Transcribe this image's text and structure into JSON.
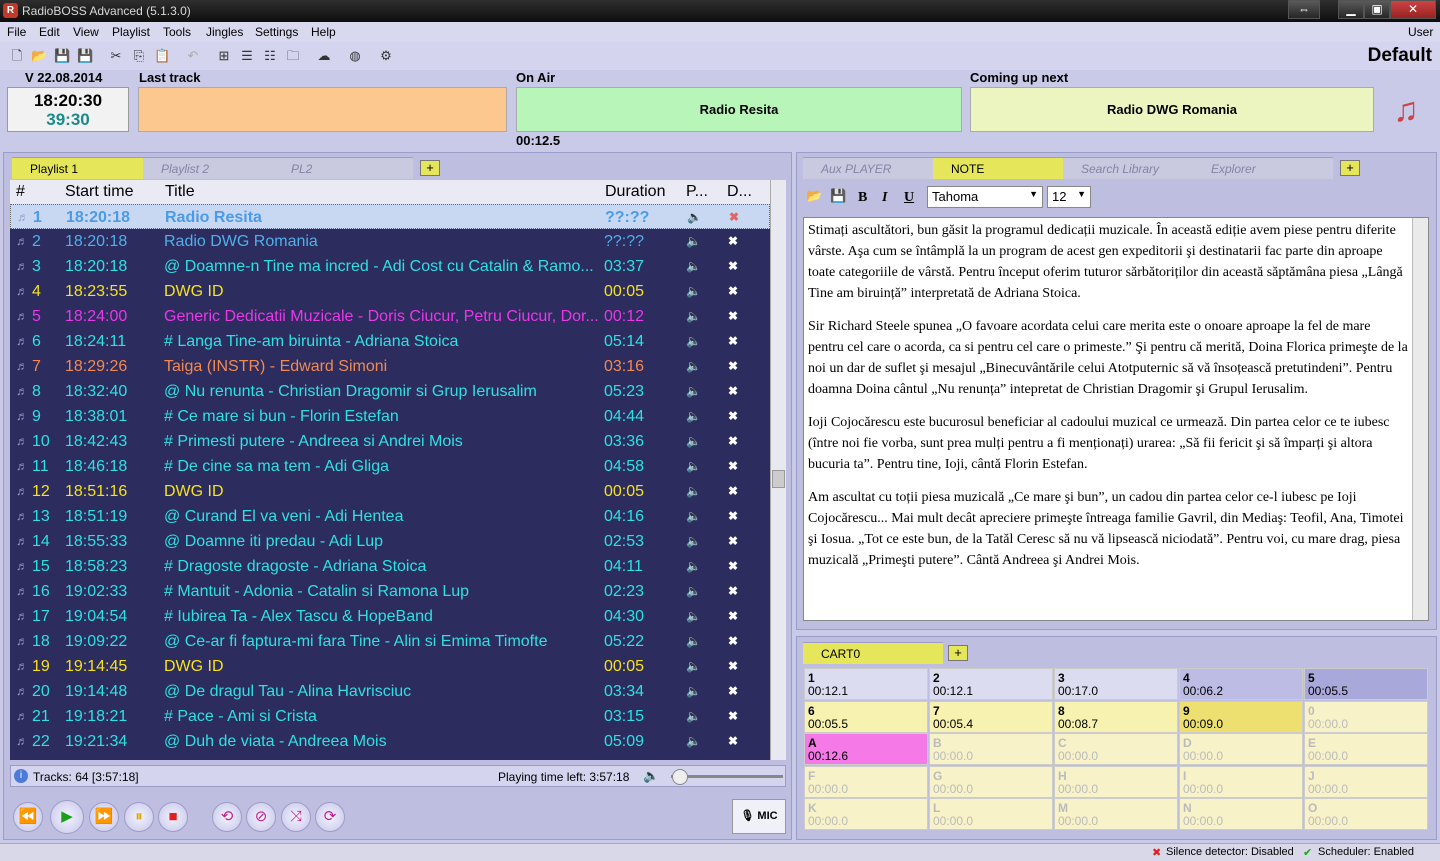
{
  "app": {
    "title": "RadioBOSS Advanced (5.1.3.0)",
    "profile": "Default",
    "user_label": "User"
  },
  "menu": [
    "File",
    "Edit",
    "View",
    "Playlist",
    "Tools",
    "Jingles",
    "Settings",
    "Help"
  ],
  "status": {
    "date": "V 22.08.2014",
    "clock": "18:20:30",
    "remaining": "39:30",
    "last_track_label": "Last track",
    "last_track": "",
    "on_air_label": "On Air",
    "on_air": "Radio Resita",
    "on_air_elapsed": "00:12.5",
    "next_label": "Coming up next",
    "next": "Radio DWG Romania",
    "colors": {
      "last": "#fcc890",
      "on_air": "#b8f5b8",
      "next": "#ecf5c0"
    }
  },
  "playlist": {
    "tabs": [
      "Playlist 1",
      "Playlist 2",
      "PL2"
    ],
    "headers": {
      "num": "#",
      "start": "Start time",
      "title": "Title",
      "duration": "Duration",
      "p": "P...",
      "d": "D..."
    },
    "rows": [
      {
        "n": "1",
        "start": "18:20:18",
        "title": "Radio Resita",
        "dur": "??:??",
        "color": "#4b9be8"
      },
      {
        "n": "2",
        "start": "18:20:18",
        "title": "Radio DWG Romania",
        "dur": "??:??",
        "color": "#4fb0ea"
      },
      {
        "n": "3",
        "start": "18:20:18",
        "title": "@ Doamne-n Tine ma incred - Adi Cost cu Catalin & Ramo...",
        "dur": "03:37",
        "color": "#2fe0e0"
      },
      {
        "n": "4",
        "start": "18:23:55",
        "title": "DWG ID",
        "dur": "00:05",
        "color": "#f5e21e"
      },
      {
        "n": "5",
        "start": "18:24:00",
        "title": "Generic Dedicatii Muzicale - Doris Ciucur, Petru Ciucur, Dor...",
        "dur": "00:12",
        "color": "#e838e8"
      },
      {
        "n": "6",
        "start": "18:24:11",
        "title": "# Langa Tine-am biruinta - Adriana Stoica",
        "dur": "05:14",
        "color": "#2fe0e0"
      },
      {
        "n": "7",
        "start": "18:29:26",
        "title": "Taiga (INSTR) - Edward Simoni",
        "dur": "03:16",
        "color": "#f08a52"
      },
      {
        "n": "8",
        "start": "18:32:40",
        "title": "@ Nu renunta - Christian Dragomir si Grup Ierusalim",
        "dur": "05:23",
        "color": "#2fe0e0"
      },
      {
        "n": "9",
        "start": "18:38:01",
        "title": "# Ce mare si bun - Florin Estefan",
        "dur": "04:44",
        "color": "#2fe0e0"
      },
      {
        "n": "10",
        "start": "18:42:43",
        "title": "# Primesti putere - Andreea si Andrei Mois",
        "dur": "03:36",
        "color": "#2fe0e0"
      },
      {
        "n": "11",
        "start": "18:46:18",
        "title": "# De cine sa ma tem - Adi Gliga",
        "dur": "04:58",
        "color": "#2fe0e0"
      },
      {
        "n": "12",
        "start": "18:51:16",
        "title": "DWG ID",
        "dur": "00:05",
        "color": "#f5e21e"
      },
      {
        "n": "13",
        "start": "18:51:19",
        "title": "@ Curand El va veni - Adi Hentea",
        "dur": "04:16",
        "color": "#2fe0e0"
      },
      {
        "n": "14",
        "start": "18:55:33",
        "title": "@ Doamne iti predau - Adi Lup",
        "dur": "02:53",
        "color": "#2fe0e0"
      },
      {
        "n": "15",
        "start": "18:58:23",
        "title": "# Dragoste dragoste - Adriana Stoica",
        "dur": "04:11",
        "color": "#2fe0e0"
      },
      {
        "n": "16",
        "start": "19:02:33",
        "title": "# Mantuit - Adonia - Catalin si Ramona Lup",
        "dur": "02:23",
        "color": "#2fe0e0"
      },
      {
        "n": "17",
        "start": "19:04:54",
        "title": "# Iubirea Ta - Alex Tascu & HopeBand",
        "dur": "04:30",
        "color": "#2fe0e0"
      },
      {
        "n": "18",
        "start": "19:09:22",
        "title": "@ Ce-ar fi faptura-mi fara Tine - Alin si Emima Timofte",
        "dur": "05:22",
        "color": "#2fe0e0"
      },
      {
        "n": "19",
        "start": "19:14:45",
        "title": "DWG ID",
        "dur": "00:05",
        "color": "#f5e21e"
      },
      {
        "n": "20",
        "start": "19:14:48",
        "title": "@ De dragul Tau - Alina Havrisciuc",
        "dur": "03:34",
        "color": "#2fe0e0"
      },
      {
        "n": "21",
        "start": "19:18:21",
        "title": "# Pace - Ami si Crista",
        "dur": "03:15",
        "color": "#2fe0e0"
      },
      {
        "n": "22",
        "start": "19:21:34",
        "title": "@ Duh de viata - Andreea  Mois",
        "dur": "05:09",
        "color": "#2fe0e0"
      }
    ],
    "tracks": "Tracks: 64 [3:57:18]",
    "time_left": "Playing time left: 3:57:18",
    "mic_label": "MIC"
  },
  "right_tabs": [
    "Aux PLAYER",
    "NOTE",
    "Search Library",
    "Explorer"
  ],
  "note": {
    "font": "Tahoma",
    "size": "12",
    "paragraphs": [
      "Stimați ascultători, bun găsit la programul dedicații muzicale. În această ediție avem piese pentru diferite vârste. Aşa cum se întâmplă la un program de acest gen expeditorii şi destinatarii fac parte din aproape toate categoriile de vârstă. Pentru început oferim tuturor sărbătoriților din această săptămâna piesa „Lângă Tine am biruință” interpretată de Adriana Stoica.",
      "Sir Richard Steele spunea „O favoare acordata celui care merita este o onoare aproape la fel de mare pentru cel care o acorda, ca si pentru cel care o primeste.” Şi pentru că merită, Doina Florica primeşte de la noi un dar de suflet şi mesajul „Binecuvântările celui Atotputernic să vă însoțească pretutindeni”. Pentru doamna Doina cântul „Nu renunța” intepretat de Christian Dragomir şi Grupul Ierusalim.",
      "Ioji Cojocărescu este bucurosul beneficiar al cadoului muzical ce urmează. Din partea celor ce te iubesc (între noi fie vorba, sunt prea mulți pentru a fi menționați) urarea: „Să fii fericit şi să împarți şi altora bucuria ta”. Pentru tine, Ioji, cântă Florin Estefan.",
      "Am ascultat cu toții piesa muzicală „Ce mare şi bun”, un cadou din partea celor ce-l iubesc pe Ioji Cojocărescu... Mai mult decât apreciere primeşte întreaga familie Gavril, din Mediaş: Teofil, Ana, Timotei şi Iosua. „Tot ce este bun, de la Tatăl Ceresc să nu vă lipsească niciodată”. Pentru voi, cu mare drag, piesa muzicală „Primeşti putere”. Cântă Andreea şi Andrei Mois."
    ]
  },
  "cart": {
    "tab": "CART0",
    "cells": [
      {
        "k": "1",
        "t": "00:12.1",
        "c": "#dcdcf0",
        "on": true
      },
      {
        "k": "2",
        "t": "00:12.1",
        "c": "#dcdcf0",
        "on": true
      },
      {
        "k": "3",
        "t": "00:17.0",
        "c": "#dcdcf0",
        "on": true
      },
      {
        "k": "4",
        "t": "00:06.2",
        "c": "#bcbce4",
        "on": true
      },
      {
        "k": "5",
        "t": "00:05.5",
        "c": "#a8a8da",
        "on": true
      },
      {
        "k": "6",
        "t": "00:05.5",
        "c": "#f7f2b0",
        "on": true
      },
      {
        "k": "7",
        "t": "00:05.4",
        "c": "#f7f2b0",
        "on": true
      },
      {
        "k": "8",
        "t": "00:08.7",
        "c": "#f7f2b0",
        "on": true
      },
      {
        "k": "9",
        "t": "00:09.0",
        "c": "#eee070",
        "on": true
      },
      {
        "k": "0",
        "t": "00:00.0",
        "c": "#f7f2c8",
        "on": false
      },
      {
        "k": "A",
        "t": "00:12.6",
        "c": "#f57ae8",
        "on": true
      },
      {
        "k": "B",
        "t": "00:00.0",
        "c": "#f7f2c8",
        "on": false
      },
      {
        "k": "C",
        "t": "00:00.0",
        "c": "#f7f2c8",
        "on": false
      },
      {
        "k": "D",
        "t": "00:00.0",
        "c": "#f7f2c8",
        "on": false
      },
      {
        "k": "E",
        "t": "00:00.0",
        "c": "#f7f2c8",
        "on": false
      },
      {
        "k": "F",
        "t": "00:00.0",
        "c": "#f7f2c8",
        "on": false
      },
      {
        "k": "G",
        "t": "00:00.0",
        "c": "#f7f2c8",
        "on": false
      },
      {
        "k": "H",
        "t": "00:00.0",
        "c": "#f7f2c8",
        "on": false
      },
      {
        "k": "I",
        "t": "00:00.0",
        "c": "#f7f2c8",
        "on": false
      },
      {
        "k": "J",
        "t": "00:00.0",
        "c": "#f7f2c8",
        "on": false
      },
      {
        "k": "K",
        "t": "00:00.0",
        "c": "#f7f2c8",
        "on": false
      },
      {
        "k": "L",
        "t": "00:00.0",
        "c": "#f7f2c8",
        "on": false
      },
      {
        "k": "M",
        "t": "00:00.0",
        "c": "#f7f2c8",
        "on": false
      },
      {
        "k": "N",
        "t": "00:00.0",
        "c": "#f7f2c8",
        "on": false
      },
      {
        "k": "O",
        "t": "00:00.0",
        "c": "#f7f2c8",
        "on": false
      }
    ]
  },
  "statusbar": {
    "silence": "Silence detector: Disabled",
    "scheduler": "Scheduler: Enabled"
  }
}
